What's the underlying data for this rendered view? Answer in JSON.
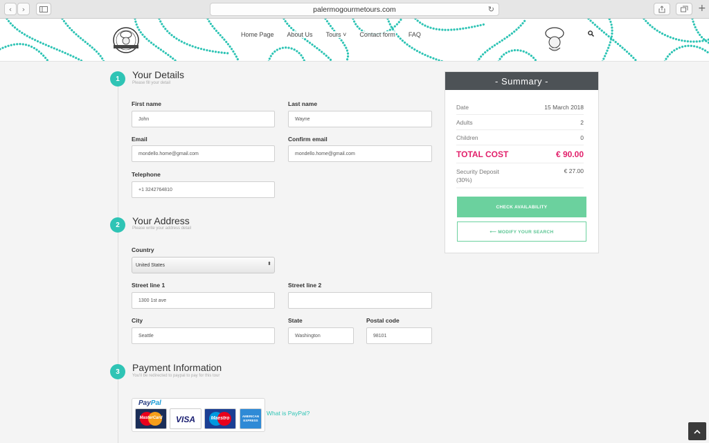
{
  "browser": {
    "url": "palermogourmetours.com"
  },
  "nav": {
    "items": [
      "Home Page",
      "About Us",
      "Tours ˅",
      "Contact form",
      "FAQ"
    ]
  },
  "steps": [
    {
      "number": "1",
      "title": "Your Details",
      "subtitle": "Please fill your detail"
    },
    {
      "number": "2",
      "title": "Your Address",
      "subtitle": "Please write your address detail"
    },
    {
      "number": "3",
      "title": "Payment Information",
      "subtitle": "You'll be redirected to paypal to pay for this tour"
    }
  ],
  "details": {
    "first_name_label": "First name",
    "first_name": "John",
    "last_name_label": "Last name",
    "last_name": "Wayne",
    "email_label": "Email",
    "email": "mondello.home@gmail.com",
    "confirm_email_label": "Confirm email",
    "confirm_email": "mondello.home@gmail.com",
    "telephone_label": "Telephone",
    "telephone": "+1 3242764810"
  },
  "address": {
    "country_label": "Country",
    "country": "United States",
    "street1_label": "Street line 1",
    "street1": "1300 1st ave",
    "street2_label": "Street line 2",
    "street2": "",
    "city_label": "City",
    "city": "Seattle",
    "state_label": "State",
    "state": "Washington",
    "postal_label": "Postal code",
    "postal": "98101"
  },
  "payment": {
    "paypal_word1": "Pay",
    "paypal_word2": "Pal",
    "cards": [
      "MasterCard",
      "VISA",
      "Maestro",
      "AMERICAN EXPRESS"
    ],
    "what_is_paypal": "What is PayPal?"
  },
  "summary": {
    "title": "- Summary -",
    "date_label": "Date",
    "date": "15 March 2018",
    "adults_label": "Adults",
    "adults": "2",
    "children_label": "Children",
    "children": "0",
    "total_label": "TOTAL COST",
    "total": "€ 90.00",
    "deposit_label": "Security Deposit",
    "deposit_pct": "(30%)",
    "deposit": "€ 27.00",
    "check_label": "CHECK AVAILABILITY",
    "modify_label": "⟵ MODIFY YOUR SEARCH"
  },
  "colors": {
    "accent": "#2fc4b5",
    "button_green": "#6bd19e",
    "total_pink": "#e2206b",
    "summary_header": "#4d5256"
  }
}
